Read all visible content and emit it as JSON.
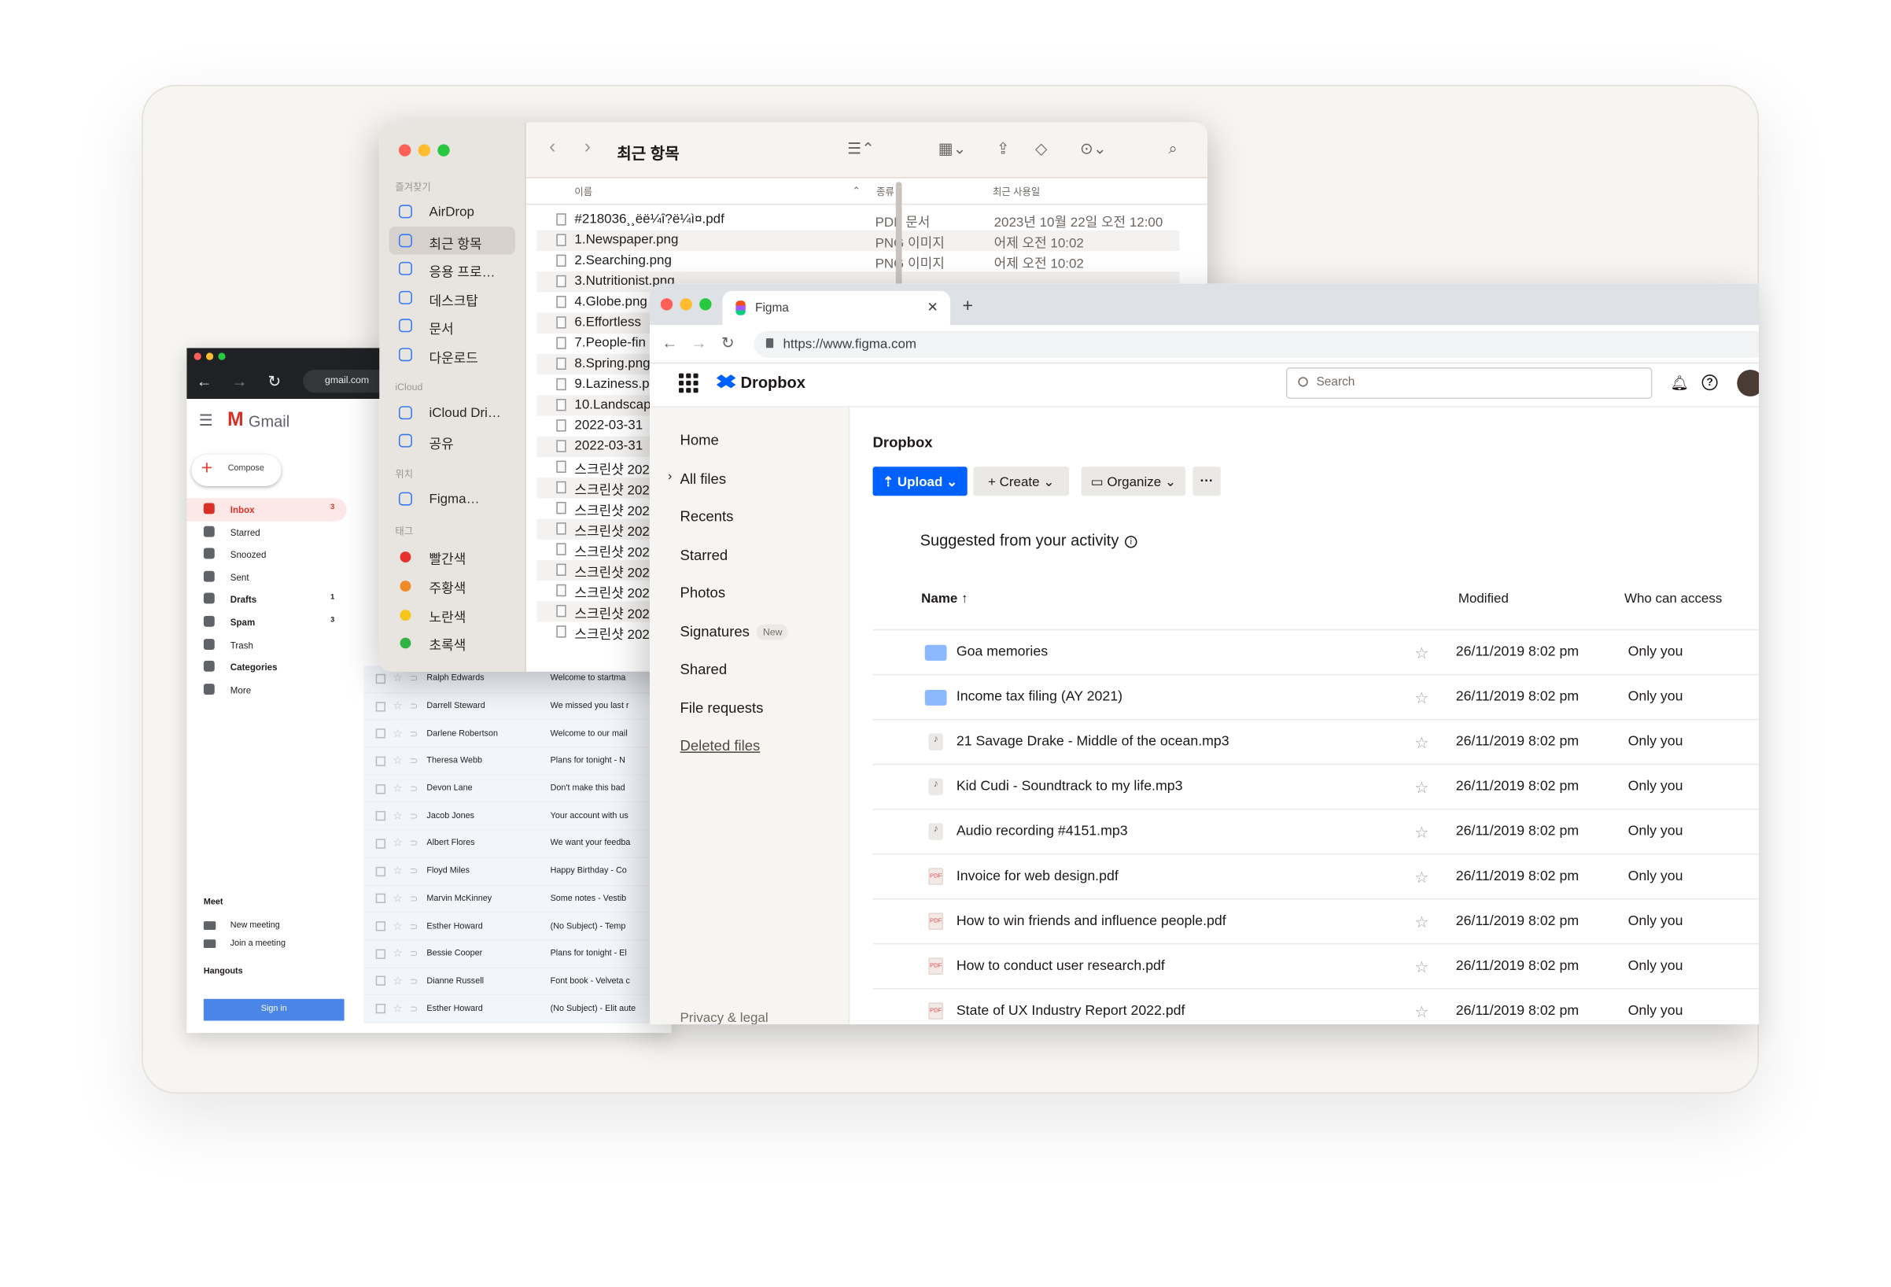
{
  "gmail": {
    "brand": "Gmail",
    "url": "gmail.com",
    "compose": "Compose",
    "nav": [
      {
        "label": "Inbox",
        "count": "3",
        "style": "active"
      },
      {
        "label": "Starred",
        "count": "",
        "style": ""
      },
      {
        "label": "Snoozed",
        "count": "",
        "style": ""
      },
      {
        "label": "Sent",
        "count": "",
        "style": ""
      },
      {
        "label": "Drafts",
        "count": "1",
        "style": "bold"
      },
      {
        "label": "Spam",
        "count": "3",
        "style": "bold"
      },
      {
        "label": "Trash",
        "count": "",
        "style": ""
      },
      {
        "label": "Categories",
        "count": "",
        "style": "bold"
      },
      {
        "label": "More",
        "count": "",
        "style": ""
      }
    ],
    "meet_title": "Meet",
    "meet_new": "New meeting",
    "meet_join": "Join a meeting",
    "hangouts_title": "Hangouts",
    "sign_in": "Sign in",
    "emails": [
      {
        "sender": "Ralph Edwards",
        "subject": "Welcome to startma"
      },
      {
        "sender": "Darrell Steward",
        "subject": "We missed you last r"
      },
      {
        "sender": "Darlene Robertson",
        "subject": "Welcome to our mail"
      },
      {
        "sender": "Theresa Webb",
        "subject": "Plans for tonight - N"
      },
      {
        "sender": "Devon Lane",
        "subject": "Don't make this bad"
      },
      {
        "sender": "Jacob Jones",
        "subject": "Your account with us"
      },
      {
        "sender": "Albert Flores",
        "subject": "We want your feedba"
      },
      {
        "sender": "Floyd Miles",
        "subject": "Happy Birthday - Co"
      },
      {
        "sender": "Marvin McKinney",
        "subject": "Some notes - Vestib"
      },
      {
        "sender": "Esther Howard",
        "subject": "(No Subject) - Temp"
      },
      {
        "sender": "Bessie Cooper",
        "subject": "Plans for tonight - El"
      },
      {
        "sender": "Dianne Russell",
        "subject": "Font book - Velveta c"
      },
      {
        "sender": "Esther Howard",
        "subject": "(No Subject) - Elit aute"
      }
    ]
  },
  "finder": {
    "title": "최근 항목",
    "sections": {
      "favorites": "즐겨찾기",
      "icloud": "iCloud",
      "locations": "위치",
      "tags": "태그"
    },
    "favorites": [
      "AirDrop",
      "최근 항목",
      "응용 프로…",
      "데스크탑",
      "문서",
      "다운로드"
    ],
    "icloud": [
      "iCloud Dri…",
      "공유"
    ],
    "locations": [
      "Figma…"
    ],
    "tags": [
      {
        "label": "빨간색",
        "color": "#e5322d"
      },
      {
        "label": "주황색",
        "color": "#f08a24"
      },
      {
        "label": "노란색",
        "color": "#f5c518"
      },
      {
        "label": "초록색",
        "color": "#2fb344"
      }
    ],
    "columns": {
      "name": "이름",
      "kind": "종류",
      "date": "최근 사용일"
    },
    "files": [
      {
        "name": "#218036¸¸ëë¼î?ë¼ì¤.pdf",
        "kind": "PDF 문서",
        "date": "2023년 10월 22일 오전 12:00"
      },
      {
        "name": "1.Newspaper.png",
        "kind": "PNG 이미지",
        "date": "어제 오전 10:02"
      },
      {
        "name": "2.Searching.png",
        "kind": "PNG 이미지",
        "date": "어제 오전 10:02"
      },
      {
        "name": "3.Nutritionist.png",
        "kind": "",
        "date": ""
      },
      {
        "name": "4.Globe.png",
        "kind": "",
        "date": ""
      },
      {
        "name": "6.Effortless",
        "kind": "",
        "date": ""
      },
      {
        "name": "7.People-fin",
        "kind": "",
        "date": ""
      },
      {
        "name": "8.Spring.png",
        "kind": "",
        "date": ""
      },
      {
        "name": "9.Laziness.p",
        "kind": "",
        "date": ""
      },
      {
        "name": "10.Landscap",
        "kind": "",
        "date": ""
      },
      {
        "name": "2022-03-31",
        "kind": "",
        "date": ""
      },
      {
        "name": "2022-03-31",
        "kind": "",
        "date": ""
      },
      {
        "name": "스크린샷 202",
        "kind": "",
        "date": ""
      },
      {
        "name": "스크린샷 202",
        "kind": "",
        "date": ""
      },
      {
        "name": "스크린샷 202",
        "kind": "",
        "date": ""
      },
      {
        "name": "스크린샷 202",
        "kind": "",
        "date": ""
      },
      {
        "name": "스크린샷 202",
        "kind": "",
        "date": ""
      },
      {
        "name": "스크린샷 202",
        "kind": "",
        "date": ""
      },
      {
        "name": "스크린샷 202",
        "kind": "",
        "date": ""
      },
      {
        "name": "스크린샷 202",
        "kind": "",
        "date": ""
      },
      {
        "name": "스크린샷 202",
        "kind": "",
        "date": ""
      }
    ]
  },
  "browser": {
    "tab_title": "Figma",
    "url": "https://www.figma.com",
    "brand": "Dropbox",
    "search_placeholder": "Search",
    "nav": [
      {
        "label": "Home"
      },
      {
        "label": "All files"
      },
      {
        "label": "Recents"
      },
      {
        "label": "Starred"
      },
      {
        "label": "Photos"
      },
      {
        "label": "Signatures",
        "badge": "New"
      },
      {
        "label": "Shared"
      },
      {
        "label": "File requests"
      },
      {
        "label": "Deleted files"
      }
    ],
    "privacy": "Privacy & legal",
    "breadcrumb": "Dropbox",
    "upload": "Upload",
    "create": "Create",
    "organize": "Organize",
    "more": "···",
    "suggested": "Suggested from your activity",
    "columns": {
      "name": "Name ↑",
      "modified": "Modified",
      "access": "Who can access"
    },
    "accent": "#0061fe",
    "files": [
      {
        "name": "Goa memories",
        "type": "folder",
        "modified": "26/11/2019 8:02 pm",
        "access": "Only you"
      },
      {
        "name": "Income tax filing (AY 2021)",
        "type": "folder",
        "modified": "26/11/2019 8:02 pm",
        "access": "Only you"
      },
      {
        "name": "21 Savage Drake - Middle of the ocean.mp3",
        "type": "audio",
        "modified": "26/11/2019 8:02 pm",
        "access": "Only you"
      },
      {
        "name": "Kid Cudi - Soundtrack to my life.mp3",
        "type": "audio",
        "modified": "26/11/2019 8:02 pm",
        "access": "Only you"
      },
      {
        "name": "Audio recording #4151.mp3",
        "type": "audio",
        "modified": "26/11/2019 8:02 pm",
        "access": "Only you"
      },
      {
        "name": "Invoice for web design.pdf",
        "type": "pdf",
        "modified": "26/11/2019 8:02 pm",
        "access": "Only you"
      },
      {
        "name": "How to win friends and influence people.pdf",
        "type": "pdf",
        "modified": "26/11/2019 8:02 pm",
        "access": "Only you"
      },
      {
        "name": "How to conduct user research.pdf",
        "type": "pdf",
        "modified": "26/11/2019 8:02 pm",
        "access": "Only you"
      },
      {
        "name": "State of UX Industry Report 2022.pdf",
        "type": "pdf",
        "modified": "26/11/2019 8:02 pm",
        "access": "Only you"
      }
    ]
  }
}
